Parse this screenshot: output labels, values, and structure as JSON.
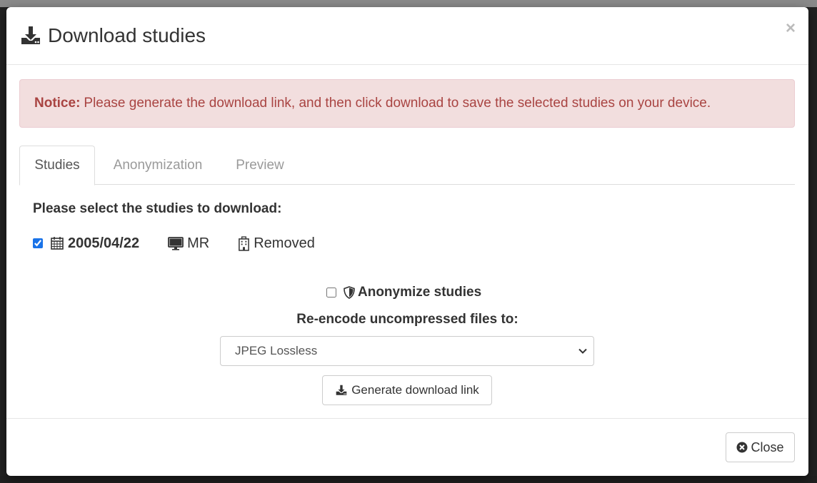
{
  "modal": {
    "title": "Download studies",
    "title_icon": "download-icon",
    "close_symbol": "×"
  },
  "notice": {
    "strong": "Notice:",
    "text": "Please generate the download link, and then click download to save the selected studies on your device.",
    "colors": {
      "background": "#f2dede",
      "text": "#a94442",
      "border": "#ebccd1"
    }
  },
  "tabs": [
    {
      "label": "Studies",
      "active": true
    },
    {
      "label": "Anonymization",
      "active": false
    },
    {
      "label": "Preview",
      "active": false
    }
  ],
  "studies": {
    "prompt": "Please select the studies to download:",
    "items": [
      {
        "checked": true,
        "date": "2005/04/22",
        "date_icon": "calendar-icon",
        "modality": "MR",
        "modality_icon": "monitor-icon",
        "institution": "Removed",
        "institution_icon": "hospital-icon"
      }
    ]
  },
  "options": {
    "anonymize_label": "Anonymize studies",
    "anonymize_checked": false,
    "anonymize_icon": "shield-icon",
    "reencode_label": "Re-encode uncompressed files to:",
    "reencode_selected": "JPEG Lossless"
  },
  "actions": {
    "generate_label": "Generate download link",
    "generate_icon": "download-icon",
    "close_label": "Close",
    "close_icon": "close-circle-icon"
  }
}
